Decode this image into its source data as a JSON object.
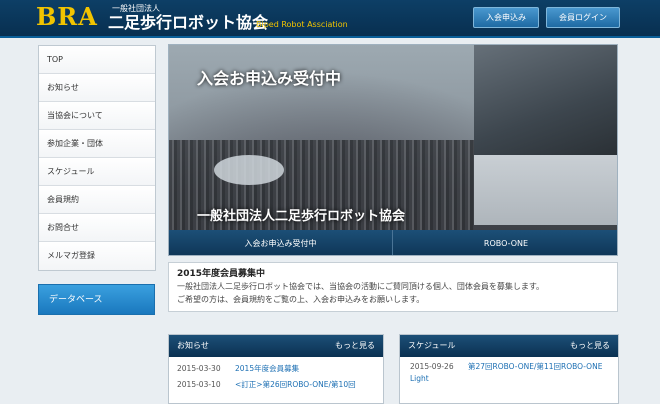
{
  "header": {
    "logo": "BRA",
    "org_type": "一般社団法人",
    "org_name": "二足歩行ロボット協会",
    "org_name_en": "Biped Robot Assciation",
    "join_button": "入会申込み",
    "login_button": "会員ログイン"
  },
  "sidebar": {
    "items": [
      {
        "label": "TOP"
      },
      {
        "label": "お知らせ"
      },
      {
        "label": "当協会について"
      },
      {
        "label": "参加企業・団体"
      },
      {
        "label": "スケジュール"
      },
      {
        "label": "会員規約"
      },
      {
        "label": "お問合せ"
      },
      {
        "label": "メルマガ登録"
      }
    ],
    "database_button": "データベース"
  },
  "hero": {
    "title": "入会お申込み受付中",
    "caption": "一般社団法人二足歩行ロボット協会",
    "tabs": [
      "入会お申込み受付中",
      "ROBO-ONE"
    ]
  },
  "recruit": {
    "title": "2015年度会員募集中",
    "line1": "一般社団法人二足歩行ロボット協会では、当協会の活動にご賛同頂ける個人、団体会員を募集します。",
    "line2": "ご希望の方は、会員規約をご覧の上、入会お申込みをお願いします。"
  },
  "news": {
    "title": "お知らせ",
    "more": "もっと見る",
    "items": [
      {
        "date": "2015-03-30",
        "title": "2015年度会員募集"
      },
      {
        "date": "2015-03-10",
        "title": "<訂正>第26回ROBO-ONE/第10回"
      }
    ]
  },
  "schedule": {
    "title": "スケジュール",
    "more": "もっと見る",
    "items": [
      {
        "date": "2015-09-26",
        "title": "第27回ROBO-ONE/第11回ROBO-ONE Light"
      }
    ]
  },
  "colors": {
    "header_bg": "#0d3f66",
    "logo": "#f2c400",
    "accent_blue": "#1a78be",
    "link": "#1c6fb3"
  }
}
